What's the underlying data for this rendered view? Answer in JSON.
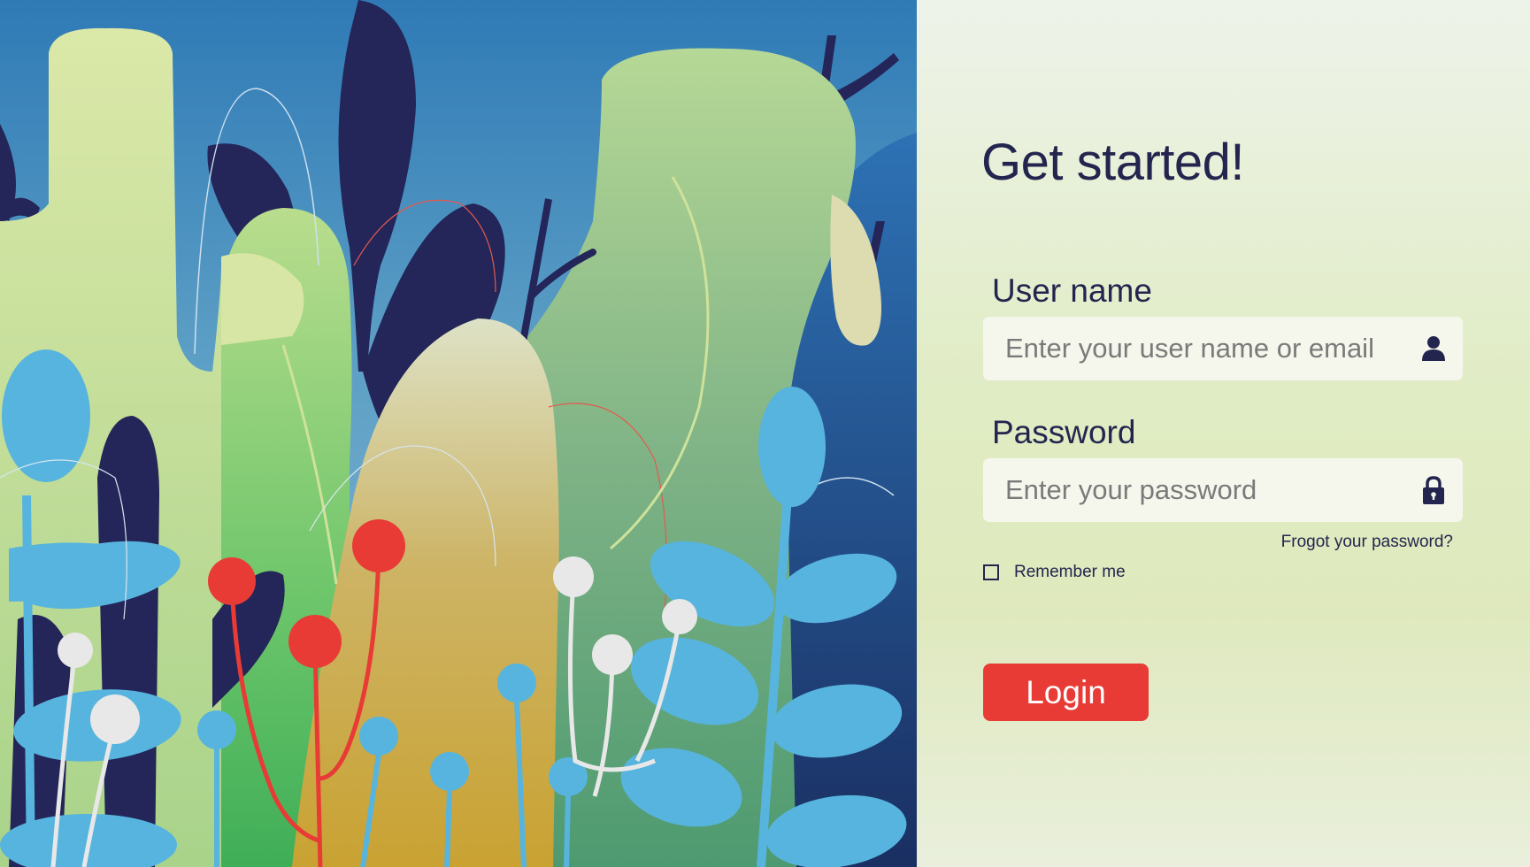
{
  "form": {
    "title": "Get started!",
    "username": {
      "label": "User name",
      "placeholder": "Enter your user name or email",
      "value": "",
      "icon": "user-icon"
    },
    "password": {
      "label": "Password",
      "placeholder": "Enter your password",
      "value": "",
      "icon": "lock-icon"
    },
    "forgot_link": "Frogot your password?",
    "remember_label": "Remember me",
    "remember_checked": false,
    "login_label": "Login"
  },
  "colors": {
    "accent": "#e83b36",
    "text": "#23254e",
    "field_bg": "#f6f7ec",
    "panel_bg": "#e0ecc4"
  }
}
